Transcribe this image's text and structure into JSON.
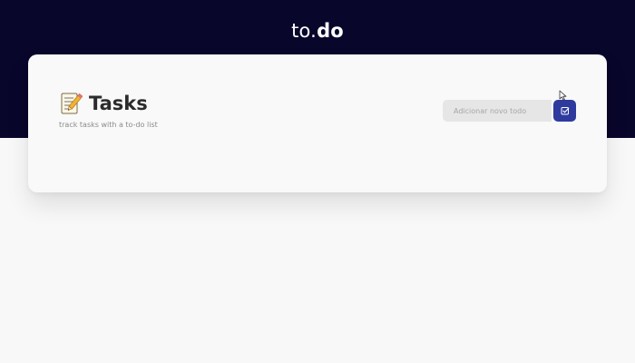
{
  "header": {
    "brand_regular": "to.",
    "brand_bold": "do"
  },
  "card": {
    "icon": "memo-icon",
    "title": "Tasks",
    "subtitle": "track tasks with a to-do list"
  },
  "form": {
    "placeholder": "Adicionar novo todo",
    "button_icon": "checkbox-edit-icon"
  },
  "colors": {
    "header_background": "#09062b",
    "page_background": "#f8f8f8",
    "card_background": "#f9f9f9",
    "button_accent": "#2e3a9e",
    "input_background": "#e6e6e6"
  }
}
